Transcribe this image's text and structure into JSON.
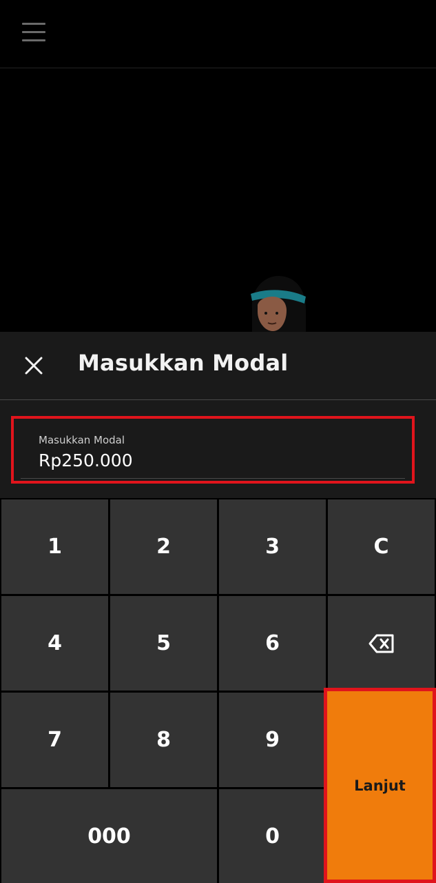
{
  "topbar": {
    "menu_icon": "hamburger-menu-icon"
  },
  "sheet": {
    "title": "Masukkan Modal",
    "close_icon": "close-icon"
  },
  "field": {
    "label": "Masukkan Modal",
    "value": "Rp250.000"
  },
  "keypad": {
    "k1": "1",
    "k2": "2",
    "k3": "3",
    "clear": "C",
    "k4": "4",
    "k5": "5",
    "k6": "6",
    "backspace_icon": "backspace-icon",
    "k7": "7",
    "k8": "8",
    "k9": "9",
    "triple_zero": "000",
    "k0": "0",
    "next": "Lanjut"
  },
  "colors": {
    "accent": "#f07c0c",
    "highlight": "#e0141c",
    "key_bg": "#333333",
    "sheet_bg": "#1a1a1a"
  }
}
